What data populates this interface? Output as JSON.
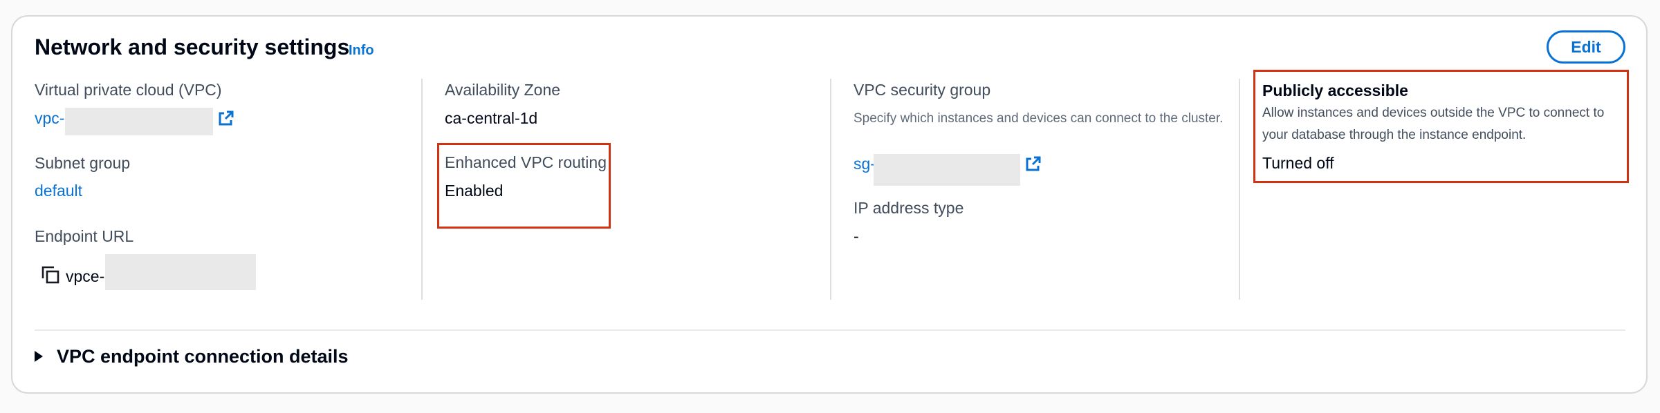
{
  "header": {
    "title": "Network and security settings",
    "info_label": "Info",
    "edit_label": "Edit"
  },
  "col1": {
    "vpc_label": "Virtual private cloud (VPC)",
    "vpc_value_prefix": "vpc-",
    "subnet_label": "Subnet group",
    "subnet_value": "default",
    "endpoint_label": "Endpoint URL",
    "endpoint_value_prefix": "vpce-"
  },
  "col2": {
    "az_label": "Availability Zone",
    "az_value": "ca-central-1d",
    "routing_label": "Enhanced VPC routing",
    "routing_value": "Enabled"
  },
  "col3": {
    "sg_label": "VPC security group",
    "sg_desc": "Specify which instances and devices can connect to the cluster.",
    "sg_value_prefix": "sg-",
    "ip_label": "IP address type",
    "ip_value": "-"
  },
  "col4": {
    "public_label": "Publicly accessible",
    "public_desc": "Allow instances and devices outside the VPC to connect to your database through the instance endpoint.",
    "public_value": "Turned off"
  },
  "expander": {
    "label": "VPC endpoint connection details"
  },
  "colors": {
    "link": "#0972d3",
    "highlight": "#d13212"
  },
  "icons": [
    "external-link-icon",
    "copy-icon",
    "caret-right-icon"
  ]
}
